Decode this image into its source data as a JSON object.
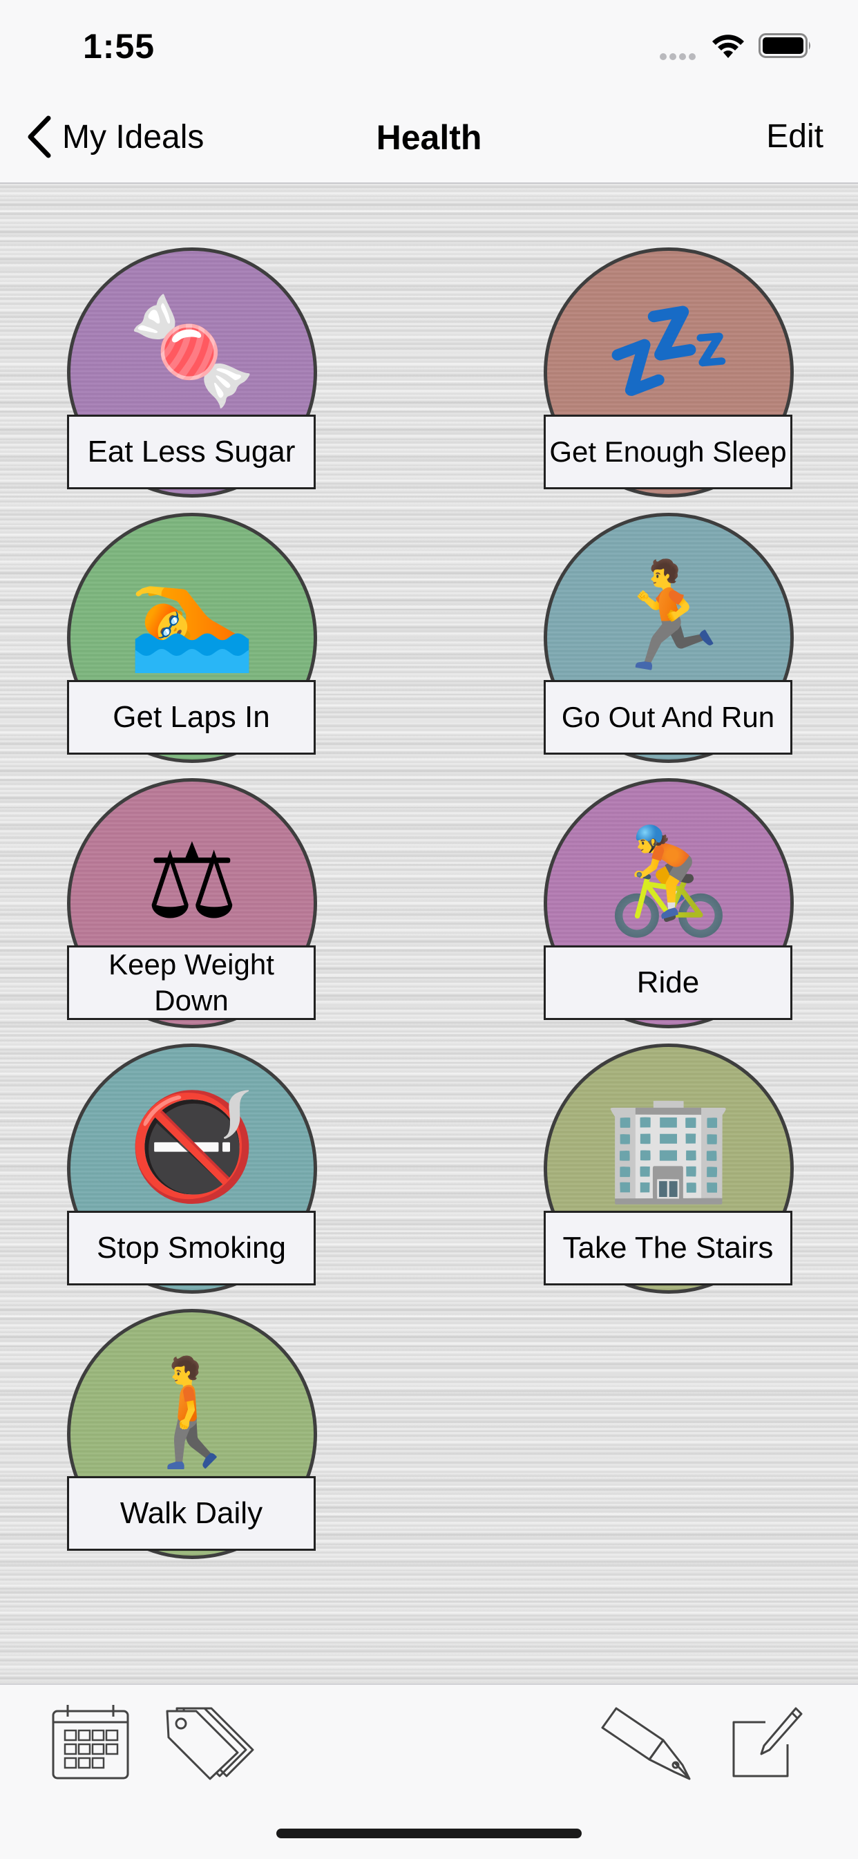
{
  "status_bar": {
    "time": "1:55"
  },
  "nav": {
    "back_label": "My Ideals",
    "title": "Health",
    "edit_label": "Edit"
  },
  "tiles": [
    {
      "label": "Eat Less Sugar",
      "emoji": "🍬",
      "icon": "candy-icon",
      "color": "#a77fb6"
    },
    {
      "label": "Get Enough Sleep",
      "emoji": "💤",
      "icon": "sleep-zzz-icon",
      "color": "#b8847a"
    },
    {
      "label": "Get Laps In",
      "emoji": "🏊",
      "icon": "swimmer-icon",
      "color": "#7db77e"
    },
    {
      "label": "Go Out And Run",
      "emoji": "🏃",
      "icon": "runner-icon",
      "color": "#7faab3"
    },
    {
      "label": "Keep Weight Down",
      "emoji": "⚖",
      "icon": "scale-icon",
      "color": "#bb7a98"
    },
    {
      "label": "Ride",
      "emoji": "🚴",
      "icon": "cyclist-icon",
      "color": "#b47bb3"
    },
    {
      "label": "Stop Smoking",
      "emoji": "🚭",
      "icon": "no-smoking-icon",
      "color": "#78acaf"
    },
    {
      "label": "Take The Stairs",
      "emoji": "🏢",
      "icon": "office-building-icon",
      "color": "#a8b37c"
    },
    {
      "label": "Walk Daily",
      "emoji": "🚶",
      "icon": "walker-icon",
      "color": "#9bb87c"
    }
  ],
  "toolbar": {
    "items": [
      {
        "icon": "calendar-icon"
      },
      {
        "icon": "tags-icon"
      },
      {
        "icon": "fountain-pen-icon"
      },
      {
        "icon": "compose-icon"
      }
    ]
  }
}
